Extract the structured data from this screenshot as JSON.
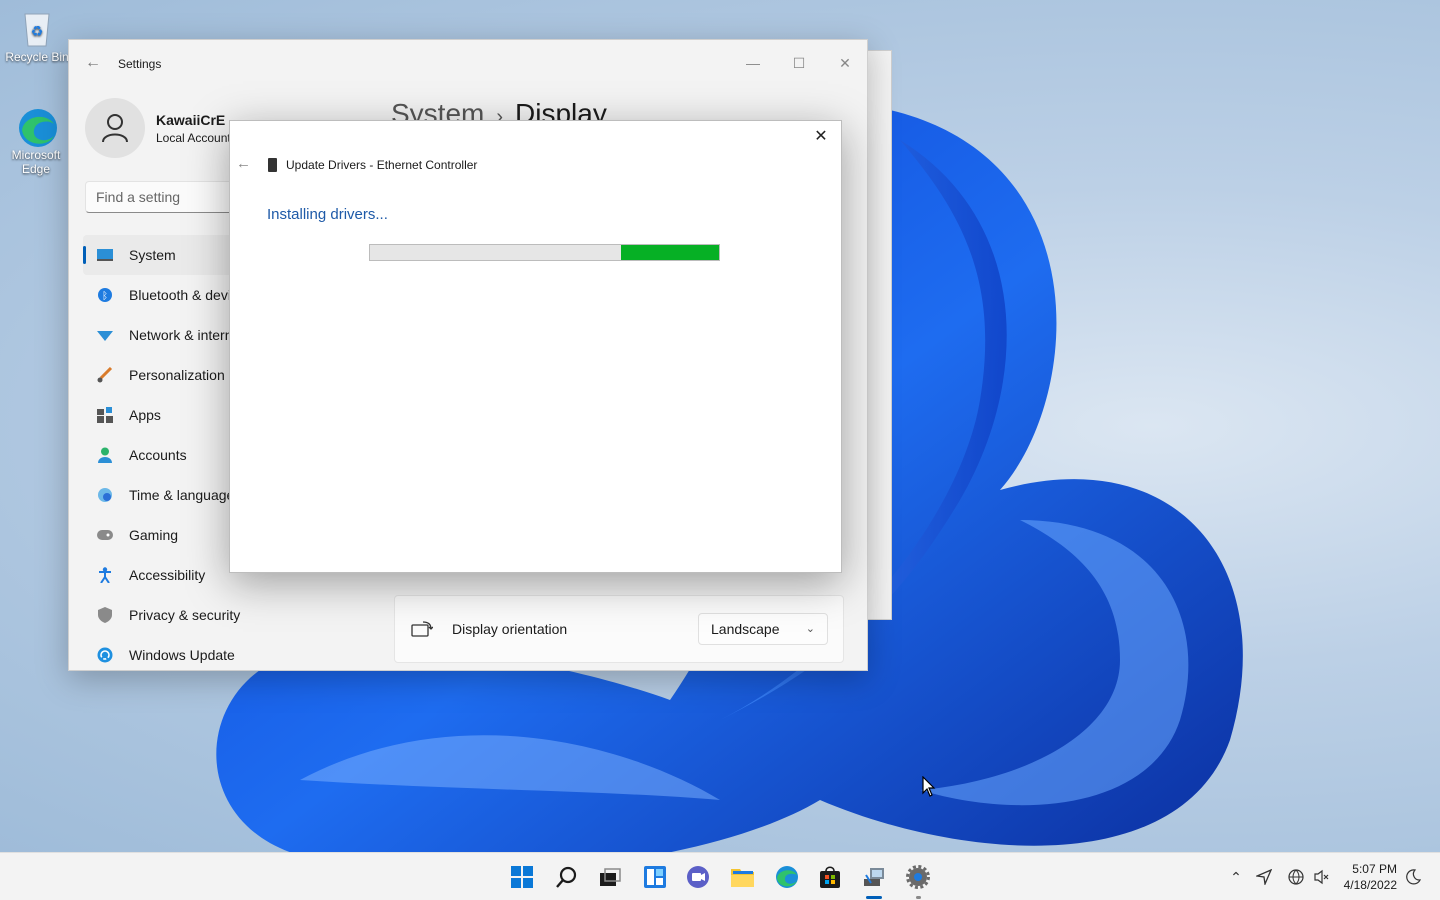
{
  "desktop": {
    "icons": [
      {
        "label": "Recycle Bin"
      },
      {
        "label": "Microsoft Edge"
      }
    ]
  },
  "settings_window": {
    "title": "Settings",
    "user": {
      "name": "KawaiiCrE",
      "account_type": "Local Account"
    },
    "search_placeholder": "Find a setting",
    "breadcrumb": {
      "parent": "System",
      "separator": "›",
      "current": "Display"
    },
    "nav_items": [
      {
        "label": "System",
        "icon": "monitor-icon",
        "active": true
      },
      {
        "label": "Bluetooth & devices",
        "icon": "bluetooth-icon"
      },
      {
        "label": "Network & internet",
        "icon": "wifi-icon"
      },
      {
        "label": "Personalization",
        "icon": "brush-icon"
      },
      {
        "label": "Apps",
        "icon": "apps-icon"
      },
      {
        "label": "Accounts",
        "icon": "person-icon"
      },
      {
        "label": "Time & language",
        "icon": "globe-clock-icon"
      },
      {
        "label": "Gaming",
        "icon": "gamepad-icon"
      },
      {
        "label": "Accessibility",
        "icon": "accessibility-icon"
      },
      {
        "label": "Privacy & security",
        "icon": "shield-icon"
      },
      {
        "label": "Windows Update",
        "icon": "sync-icon"
      }
    ],
    "display_orientation": {
      "label": "Display orientation",
      "value": "Landscape"
    }
  },
  "dialog": {
    "title": "Update Drivers - Ethernet Controller",
    "status": "Installing drivers...",
    "progress_fraction": 0.28
  },
  "taskbar": {
    "apps": [
      "windows-start-icon",
      "search-icon",
      "task-view-icon",
      "widgets-icon",
      "chat-icon",
      "file-explorer-icon",
      "edge-icon",
      "store-icon",
      "device-manager-icon",
      "settings-icon"
    ],
    "clock": {
      "time": "5:07 PM",
      "date": "4/18/2022"
    }
  },
  "colors": {
    "accent": "#005fb8",
    "progress": "#06b025",
    "status_text": "#1e5aa8"
  }
}
